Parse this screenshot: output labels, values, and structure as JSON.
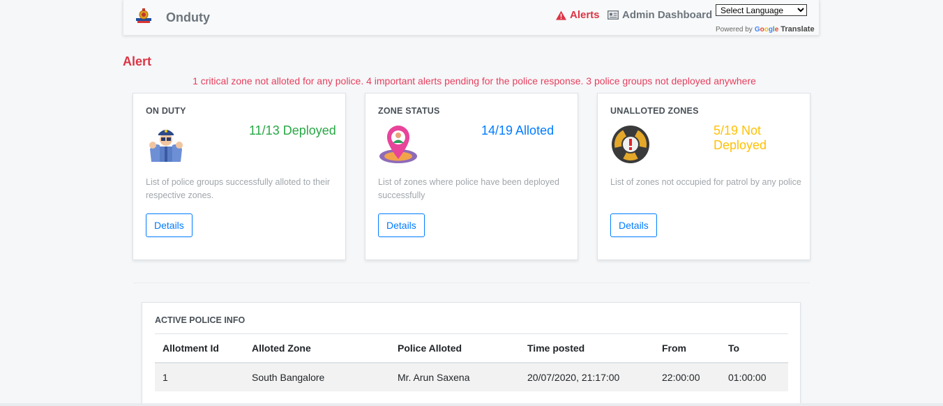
{
  "navbar": {
    "brand": "Onduty",
    "alerts_label": "Alerts",
    "admin_label": "Admin Dashboard",
    "language_select": "Select Language",
    "powered_by": "Powered by",
    "google_word": "Google",
    "translate_word": "Translate"
  },
  "alert": {
    "heading": "Alert",
    "message": "1 critical zone not alloted for any police. 4 important alerts pending for the police response. 3 police groups not deployed anywhere"
  },
  "cards": [
    {
      "title": "ON DUTY",
      "icon": "police-officer-icon",
      "value": "11/13 Deployed",
      "value_color": "#28a745",
      "description": "List of police groups successfully alloted to their respective zones.",
      "button": "Details"
    },
    {
      "title": "ZONE STATUS",
      "icon": "location-pin-icon",
      "value": "14/19 Alloted",
      "value_color": "#007bff",
      "description": "List of zones where police have been deployed successfully",
      "button": "Details"
    },
    {
      "title": "UNALLOTED ZONES",
      "icon": "hazard-warning-icon",
      "value": "5/19 Not Deployed",
      "value_color": "#ffc107",
      "description": "List of zones not occupied for patrol by any police",
      "button": "Details"
    }
  ],
  "table": {
    "title": "ACTIVE POLICE INFO",
    "headers": [
      "Allotment Id",
      "Alloted Zone",
      "Police Alloted",
      "Time posted",
      "From",
      "To"
    ],
    "rows": [
      [
        "1",
        "South Bangalore",
        "Mr. Arun Saxena",
        "20/07/2020, 21:17:00",
        "22:00:00",
        "01:00:00"
      ]
    ]
  },
  "colors": {
    "danger": "#dc3545",
    "alert_text": "#e83e5c",
    "primary": "#007bff",
    "success": "#28a745",
    "warning": "#ffc107"
  }
}
